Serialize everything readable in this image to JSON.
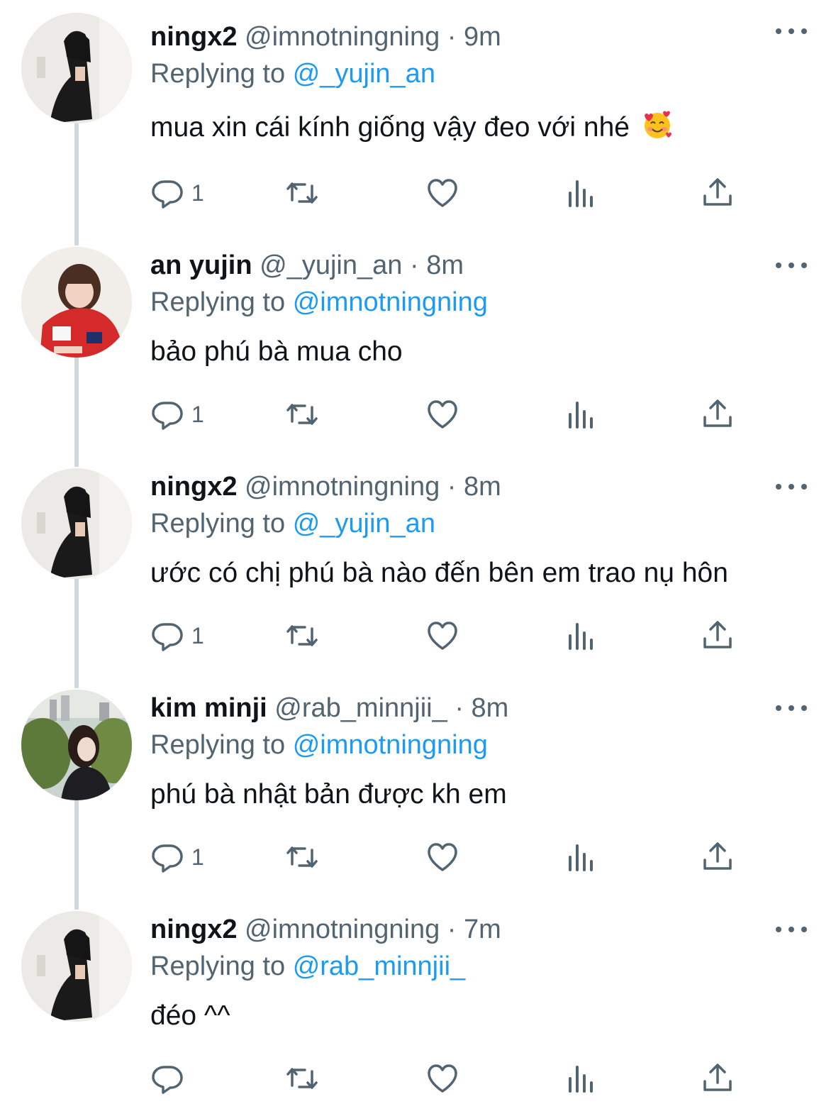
{
  "separator": "·",
  "replying_prefix": "Replying to",
  "tweets": [
    {
      "avatar": "ningx2-avatar",
      "name": "ningx2",
      "handle": "@imnotningning",
      "time": "9m",
      "reply_to": "@_yujin_an",
      "text": "mua xin cái kính giống vậy đeo với nhé",
      "emoji": "smiling-face-with-hearts-emoji",
      "reply_count": "1"
    },
    {
      "avatar": "an-yujin-avatar",
      "name": "an yujin",
      "handle": "@_yujin_an",
      "time": "8m",
      "reply_to": "@imnotningning",
      "text": "bảo phú bà mua cho",
      "reply_count": "1"
    },
    {
      "avatar": "ningx2-avatar",
      "name": "ningx2",
      "handle": "@imnotningning",
      "time": "8m",
      "reply_to": "@_yujin_an",
      "text": "ước có chị phú bà nào đến bên em trao nụ hôn",
      "reply_count": "1"
    },
    {
      "avatar": "kim-minji-avatar",
      "name": "kim minji",
      "handle": "@rab_minnjii_",
      "time": "8m",
      "reply_to": "@imnotningning",
      "text": "phú bà nhật bản được kh em",
      "reply_count": "1"
    },
    {
      "avatar": "ningx2-avatar",
      "name": "ningx2",
      "handle": "@imnotningning",
      "time": "7m",
      "reply_to": "@rab_minnjii_",
      "text": "đéo ^^",
      "reply_count": ""
    }
  ],
  "icons": {
    "reply": "reply-icon",
    "retweet": "retweet-icon",
    "like": "like-icon",
    "views": "views-icon",
    "share": "share-icon",
    "more": "more-icon"
  },
  "colors": {
    "text": "#0f1419",
    "secondary": "#536471",
    "link": "#1d9bf0",
    "thread_line": "#cfd9de"
  }
}
